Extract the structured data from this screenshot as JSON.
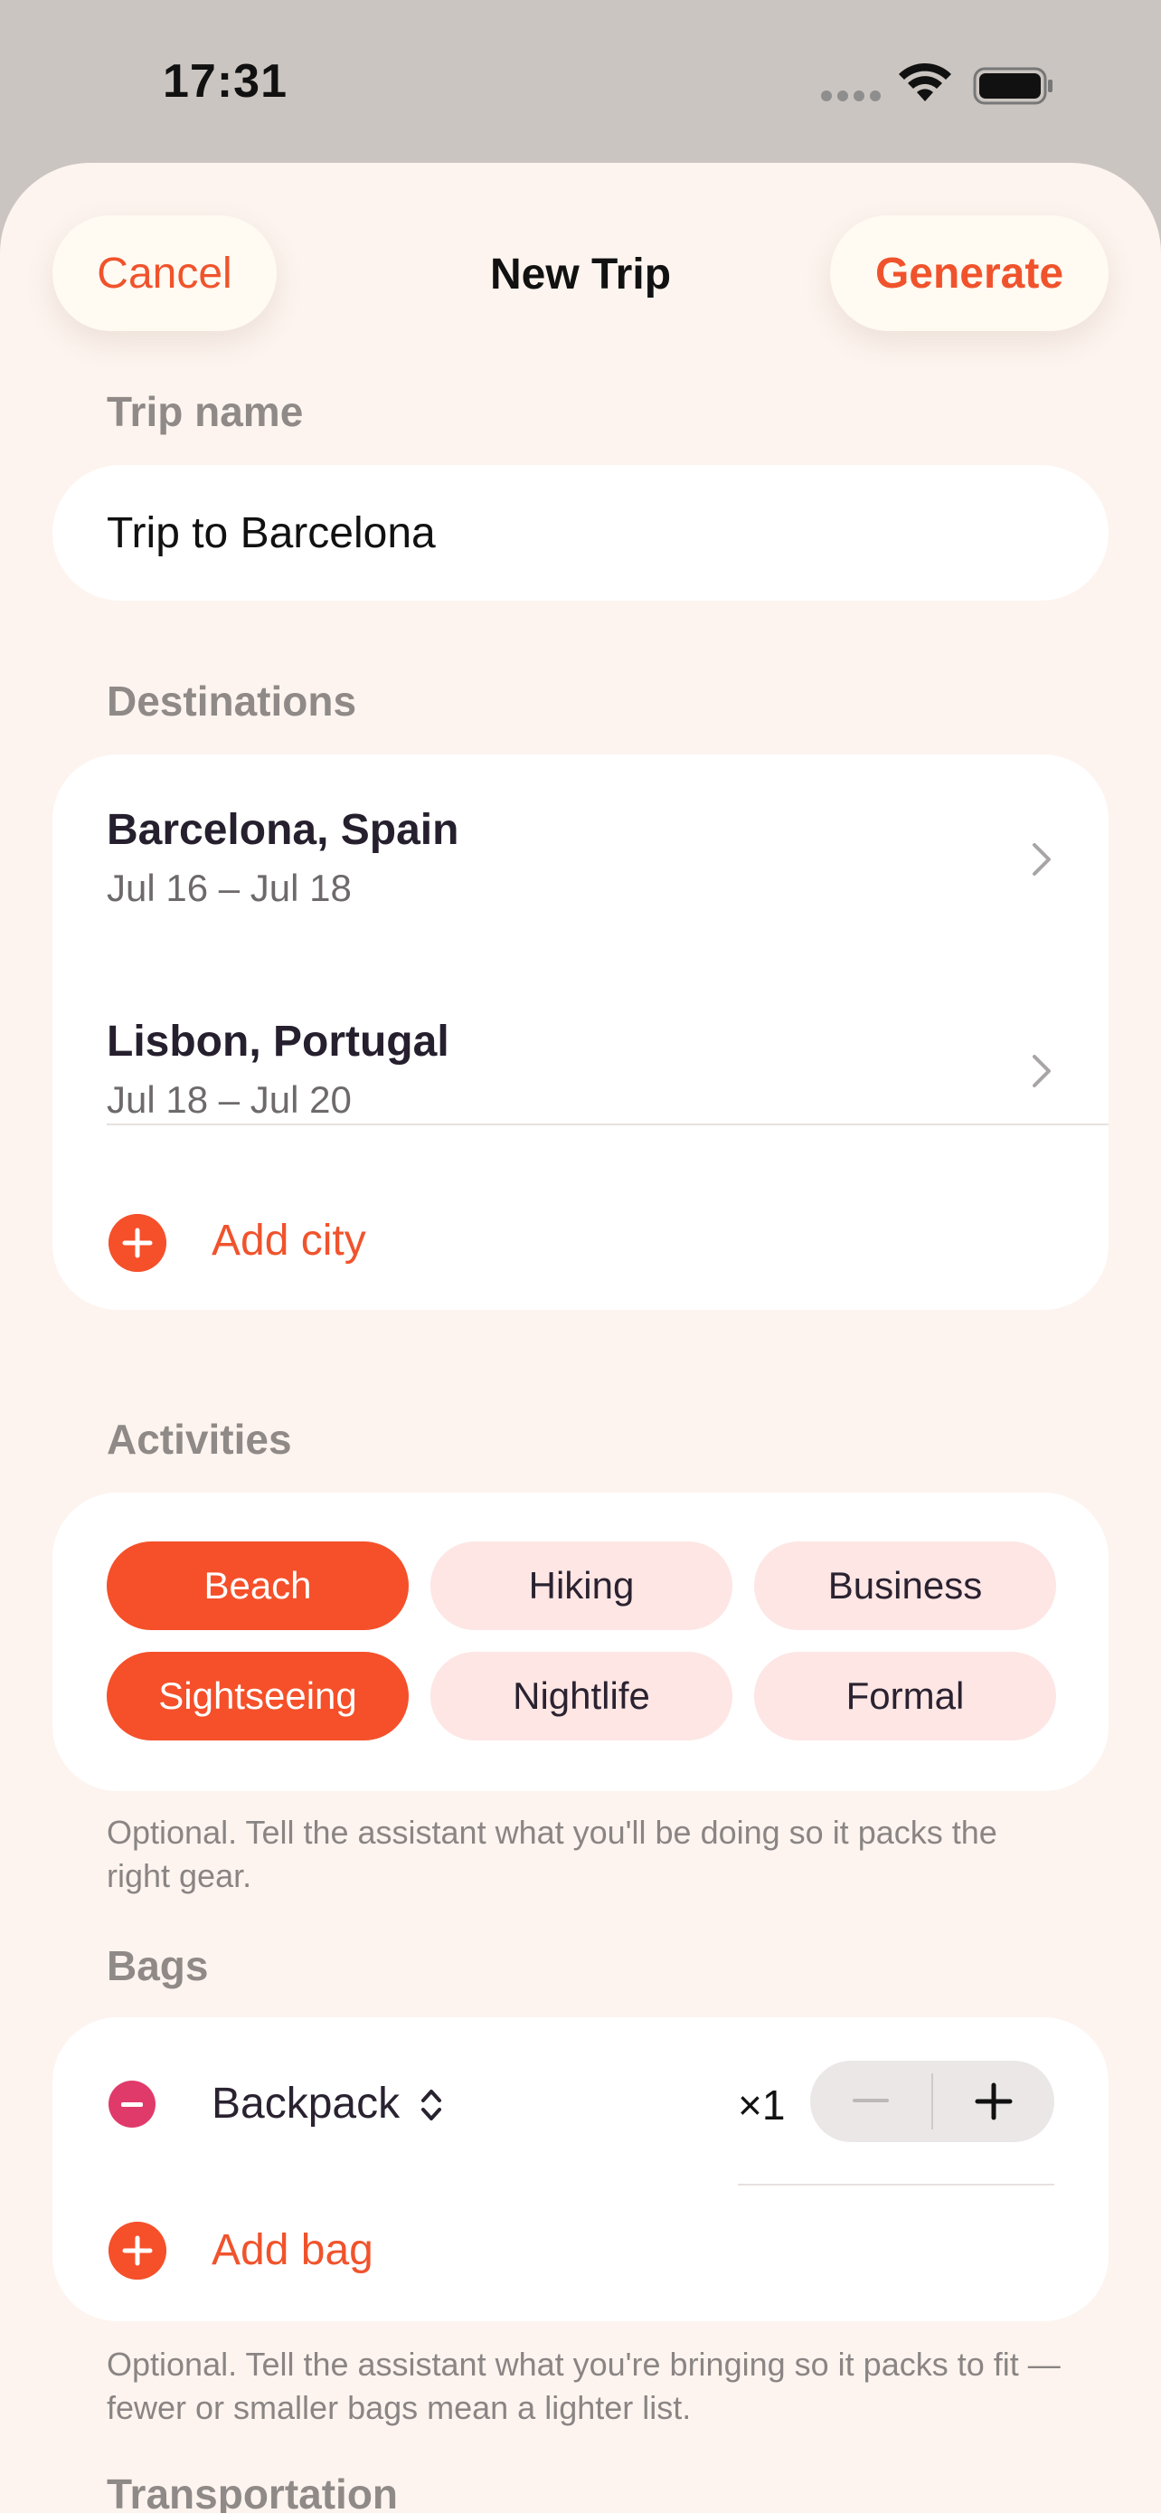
{
  "status_bar": {
    "time": "17:31"
  },
  "nav": {
    "cancel_label": "Cancel",
    "title": "New Trip",
    "generate_label": "Generate"
  },
  "trip_name": {
    "label": "Trip name",
    "value": "Trip to Barcelona"
  },
  "destinations": {
    "label": "Destinations",
    "items": [
      {
        "name": "Barcelona, Spain",
        "dates": "Jul 16 – Jul 18"
      },
      {
        "name": "Lisbon, Portugal",
        "dates": "Jul 18 – Jul 20"
      }
    ],
    "add_label": "Add city"
  },
  "activities": {
    "label": "Activities",
    "chips": [
      {
        "label": "Beach",
        "selected": true
      },
      {
        "label": "Hiking",
        "selected": false
      },
      {
        "label": "Business",
        "selected": false
      },
      {
        "label": "Sightseeing",
        "selected": true
      },
      {
        "label": "Nightlife",
        "selected": false
      },
      {
        "label": "Formal",
        "selected": false
      }
    ],
    "help": "Optional. Tell the assistant what you'll be doing so it packs the right gear."
  },
  "bags": {
    "label": "Bags",
    "items": [
      {
        "name": "Backpack",
        "quantity": "×1"
      }
    ],
    "add_label": "Add bag",
    "help": "Optional. Tell the assistant what you're bringing so it packs to fit — fewer or smaller bags mean a lighter list."
  },
  "transportation": {
    "label": "Transportation"
  },
  "colors": {
    "accent": "#f5502a",
    "sheet_background": "#fdf4ef",
    "chip_inactive": "#fde6e4",
    "remove_red": "#e03a6b"
  },
  "icons": {
    "status": [
      "signal-dots-icon",
      "wifi-icon",
      "battery-icon"
    ],
    "rows": [
      "chevron-right-icon",
      "plus-circle-icon",
      "minus-circle-icon",
      "up-down-chevron-icon",
      "minus-icon",
      "plus-icon"
    ]
  }
}
